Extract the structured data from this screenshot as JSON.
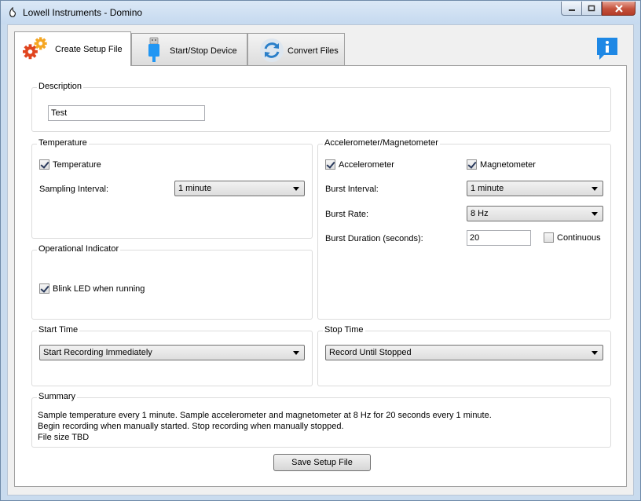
{
  "window": {
    "title": "Lowell Instruments - Domino"
  },
  "tabs": [
    {
      "label": "Create Setup File",
      "icon": "gears-icon",
      "active": true
    },
    {
      "label": "Start/Stop Device",
      "icon": "usb-icon",
      "active": false
    },
    {
      "label": "Convert Files",
      "icon": "sync-icon",
      "active": false
    }
  ],
  "info_icon": "info-icon",
  "description": {
    "title": "Description",
    "value": "Test"
  },
  "temperature": {
    "title": "Temperature",
    "checkbox_label": "Temperature",
    "checked": true,
    "interval_label": "Sampling Interval:",
    "interval_value": "1 minute"
  },
  "operational": {
    "title": "Operational Indicator",
    "checkbox_label": "Blink LED when running",
    "checked": true
  },
  "accel": {
    "title": "Accelerometer/Magnetometer",
    "accel_label": "Accelerometer",
    "accel_checked": true,
    "mag_label": "Magnetometer",
    "mag_checked": true,
    "burst_interval_label": "Burst Interval:",
    "burst_interval_value": "1 minute",
    "burst_rate_label": "Burst Rate:",
    "burst_rate_value": "8 Hz",
    "burst_duration_label": "Burst Duration (seconds):",
    "burst_duration_value": "20",
    "continuous_label": "Continuous",
    "continuous_checked": false
  },
  "start_time": {
    "title": "Start Time",
    "value": "Start Recording Immediately"
  },
  "stop_time": {
    "title": "Stop Time",
    "value": "Record Until Stopped"
  },
  "summary": {
    "title": "Summary",
    "line1": "Sample temperature every 1 minute. Sample accelerometer and magnetometer at 8 Hz for 20 seconds every 1 minute.",
    "line2": "Begin recording when manually started. Stop recording when manually stopped.",
    "line3": "File size TBD"
  },
  "save_button": "Save Setup File",
  "colors": {
    "info_blue": "#1e88e5",
    "gear_orange": "#f5a623",
    "gear_red": "#e0451f",
    "usb_blue": "#2196f3",
    "sync_blue": "#2a7fc9"
  }
}
